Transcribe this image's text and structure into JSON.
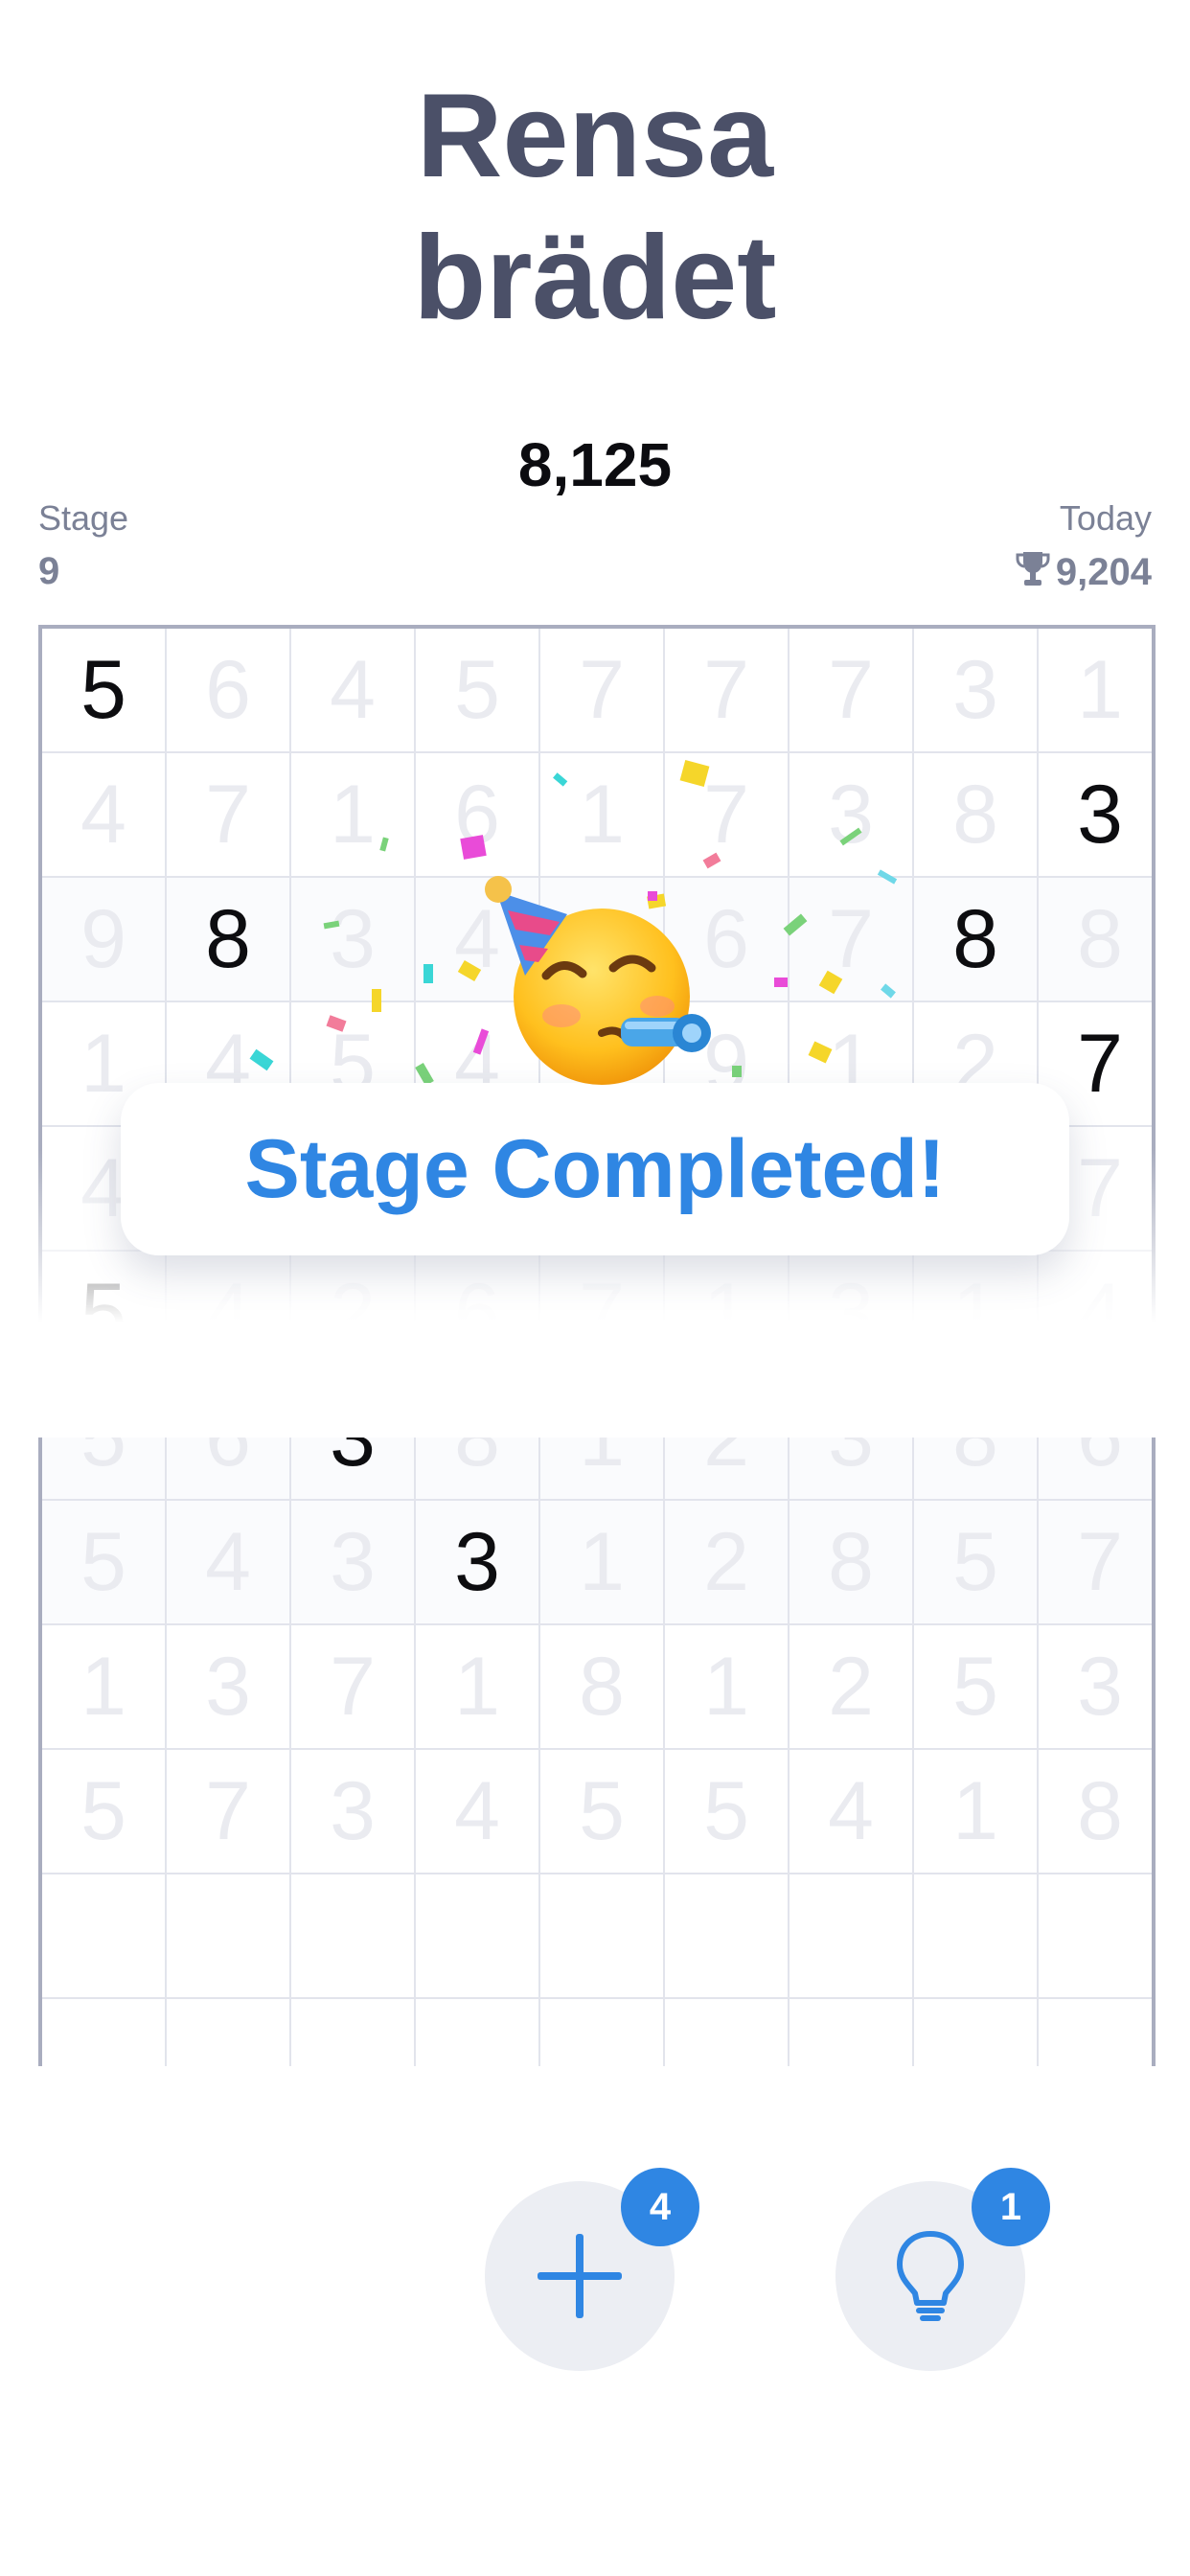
{
  "header": {
    "title_line1": "Rensa",
    "title_line2": "brädet",
    "score": "8,125"
  },
  "stats": {
    "stage_label": "Stage",
    "stage_value": "9",
    "today_label": "Today",
    "today_value": "9,204",
    "today_icon": "trophy-icon"
  },
  "board": {
    "rows": [
      [
        "5",
        "6",
        "4",
        "5",
        "7",
        "7",
        "7",
        "3",
        "1"
      ],
      [
        "4",
        "7",
        "1",
        "6",
        "1",
        "7",
        "3",
        "8",
        "3"
      ],
      [
        "9",
        "8",
        "3",
        "4",
        "5",
        "6",
        "7",
        "8",
        "8"
      ],
      [
        "1",
        "4",
        "5",
        "4",
        "5",
        "9",
        "1",
        "2",
        "7"
      ],
      [
        "4",
        "",
        "",
        "",
        "",
        "",
        "",
        "",
        "7"
      ],
      [
        "5",
        "4",
        "2",
        "6",
        "7",
        "1",
        "3",
        "1",
        "4"
      ],
      [
        "5",
        "6",
        "3",
        "8",
        "1",
        "2",
        "3",
        "8",
        "6"
      ],
      [
        "5",
        "4",
        "3",
        "3",
        "1",
        "2",
        "8",
        "5",
        "7"
      ],
      [
        "1",
        "3",
        "7",
        "1",
        "8",
        "1",
        "2",
        "5",
        "3"
      ],
      [
        "5",
        "7",
        "3",
        "4",
        "5",
        "5",
        "4",
        "1",
        "8"
      ],
      [
        "",
        "",
        "",
        "",
        "",
        "",
        "",
        "",
        ""
      ],
      [
        "",
        "",
        "",
        "",
        "",
        "",
        "",
        "",
        ""
      ]
    ],
    "active_cells": [
      [
        0,
        0
      ],
      [
        1,
        8
      ],
      [
        3,
        8
      ],
      [
        5,
        0
      ]
    ],
    "selected_cells": [
      [
        2,
        1
      ],
      [
        2,
        7
      ],
      [
        6,
        2
      ],
      [
        7,
        3
      ]
    ],
    "tinted_rows": [
      2,
      6,
      7
    ]
  },
  "overlay": {
    "message": "Stage Completed!",
    "emoji": "partying-face"
  },
  "controls": {
    "add": {
      "icon": "plus-icon",
      "badge": "4"
    },
    "hint": {
      "icon": "lightbulb-icon",
      "badge": "1"
    }
  },
  "colors": {
    "accent": "#2f86e3",
    "title": "#4b5068",
    "selected": "#bfe0fb"
  }
}
